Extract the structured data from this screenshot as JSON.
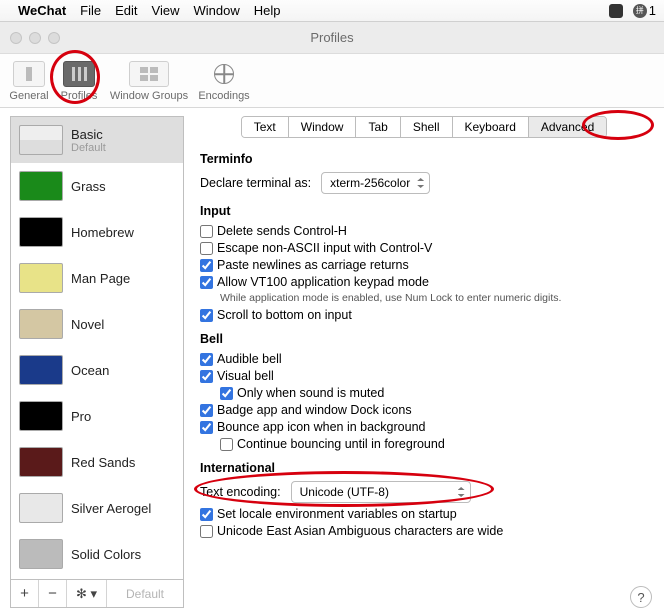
{
  "menu": {
    "app": "WeChat",
    "items": [
      "File",
      "Edit",
      "View",
      "Window",
      "Help"
    ],
    "badge": "1"
  },
  "window_title": "Profiles",
  "toolbar": [
    {
      "name": "general",
      "label": "General"
    },
    {
      "name": "profiles",
      "label": "Profiles"
    },
    {
      "name": "window-groups",
      "label": "Window Groups"
    },
    {
      "name": "encodings",
      "label": "Encodings"
    }
  ],
  "sidebar": {
    "profiles": [
      {
        "name": "Basic",
        "default_label": "Default",
        "selected": true
      },
      {
        "name": "Grass"
      },
      {
        "name": "Homebrew"
      },
      {
        "name": "Man Page"
      },
      {
        "name": "Novel"
      },
      {
        "name": "Ocean"
      },
      {
        "name": "Pro"
      },
      {
        "name": "Red Sands"
      },
      {
        "name": "Silver Aerogel"
      },
      {
        "name": "Solid Colors"
      }
    ],
    "footer": {
      "add": "+",
      "remove": "−",
      "gear": "✻ ▾",
      "default_btn": "Default"
    }
  },
  "tabs": [
    "Text",
    "Window",
    "Tab",
    "Shell",
    "Keyboard",
    "Advanced"
  ],
  "active_tab": "Advanced",
  "terminfo": {
    "heading": "Terminfo",
    "declare_label": "Declare terminal as:",
    "declare_value": "xterm-256color"
  },
  "input": {
    "heading": "Input",
    "delete_ctrl_h": {
      "label": "Delete sends Control-H",
      "checked": false
    },
    "escape_nonascii": {
      "label": "Escape non-ASCII input with Control-V",
      "checked": false
    },
    "paste_newlines": {
      "label": "Paste newlines as carriage returns",
      "checked": true
    },
    "allow_vt100": {
      "label": "Allow VT100 application keypad mode",
      "checked": true
    },
    "vt100_hint": "While application mode is enabled, use Num Lock to enter numeric digits.",
    "scroll_bottom": {
      "label": "Scroll to bottom on input",
      "checked": true
    }
  },
  "bell": {
    "heading": "Bell",
    "audible": {
      "label": "Audible bell",
      "checked": true
    },
    "visual": {
      "label": "Visual bell",
      "checked": true
    },
    "only_muted": {
      "label": "Only when sound is muted",
      "checked": true
    },
    "badge": {
      "label": "Badge app and window Dock icons",
      "checked": true
    },
    "bounce": {
      "label": "Bounce app icon when in background",
      "checked": true
    },
    "continue_bounce": {
      "label": "Continue bouncing until in foreground",
      "checked": false
    }
  },
  "international": {
    "heading": "International",
    "encoding_label": "Text encoding:",
    "encoding_value": "Unicode (UTF-8)",
    "set_locale": {
      "label": "Set locale environment variables on startup",
      "checked": true
    },
    "east_asian": {
      "label": "Unicode East Asian Ambiguous characters are wide",
      "checked": false
    }
  },
  "help_label": "?"
}
